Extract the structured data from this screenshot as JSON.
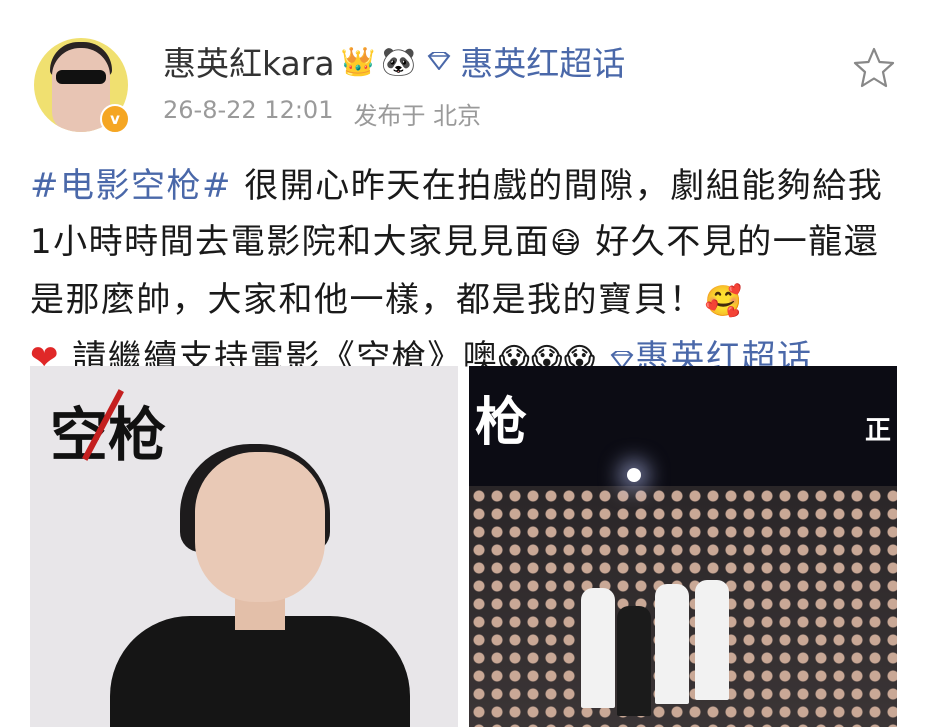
{
  "post": {
    "username": "惠英紅kara",
    "badge_crown": "👑",
    "badge_panda": "🐼",
    "super_topic": "惠英红超话",
    "time": "26-8-22 12:01",
    "location": "发布于 北京",
    "verified_mark": "v"
  },
  "content": {
    "hashtag": "#电影空枪#",
    "line1": " 很開心昨天在拍戲的間隙，劇組能夠給我1小時時間去電影院和大家見見面",
    "emoji1": "😷",
    "line2": " 好久不見的一龍還是那麼帥，大家和他一樣，都是我的寶貝！",
    "emoji2": "🥰",
    "heart": "❤",
    "line3": " 請繼續支持電影《空槍》噢",
    "emoji3": "😱😱😱",
    "topic_link": "惠英红超话"
  },
  "images": {
    "left_title": "空枪",
    "right_title": "枪",
    "right_corner": "正"
  },
  "colors": {
    "link": "#4a68a9",
    "meta": "#9a9a9a",
    "verified": "#f5a623"
  },
  "icons": {
    "star": "star-icon",
    "diamond": "diamond-icon"
  }
}
